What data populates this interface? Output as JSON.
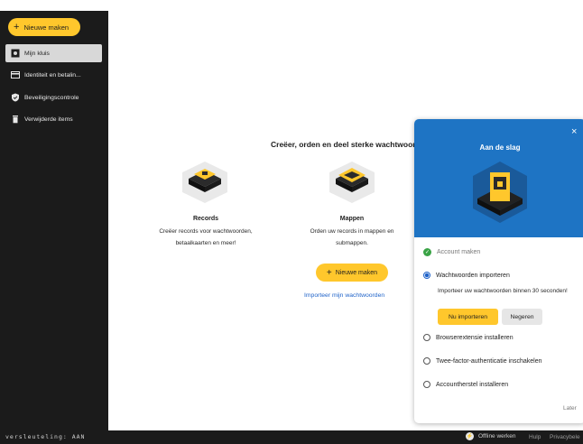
{
  "sidebar": {
    "new_label": "Nieuwe maken",
    "items": [
      {
        "label": "Mijn kluis",
        "icon": "vault-icon",
        "active": true
      },
      {
        "label": "Identiteit en betalin...",
        "icon": "card-icon",
        "active": false
      },
      {
        "label": "Beveiligingscontrole",
        "icon": "shield-icon",
        "active": false
      },
      {
        "label": "Verwijderde items",
        "icon": "trash-icon",
        "active": false
      }
    ]
  },
  "main": {
    "headline": "Creëer, orden en deel sterke wachtwoor",
    "cards": [
      {
        "title": "Records",
        "desc_lines": [
          "Creëer records voor wachtwoorden,",
          "betaalkaarten en meer!"
        ]
      },
      {
        "title": "Mappen",
        "desc_lines": [
          "Orden uw records in mappen en",
          "submappen."
        ]
      }
    ],
    "new_label": "Nieuwe maken",
    "import_link": "Importeer mijn wachtwoorden"
  },
  "panel": {
    "title": "Aan de slag",
    "close": "×",
    "steps": [
      {
        "label": "Account maken",
        "state": "done"
      },
      {
        "label": "Wachtwoorden importeren",
        "state": "current"
      },
      {
        "label": "Browserextensie installeren",
        "state": "todo"
      },
      {
        "label": "Twee-factor-authenticatie inschakelen",
        "state": "todo"
      },
      {
        "label": "Accountherstel installeren",
        "state": "todo"
      }
    ],
    "import_desc": "Importeer uw wachtwoorden binnen 30 seconden!",
    "import_now": "Nu importeren",
    "ignore": "Negeren",
    "later": "Later"
  },
  "footer": {
    "encryption": "versleuteling: AAN",
    "offline": "Offline werken",
    "help": "Hulp",
    "privacy": "Privacybele"
  },
  "colors": {
    "accent": "#ffc72c",
    "brand_blue": "#1e74c4",
    "link": "#1f63c9",
    "sidebar": "#1b1b1b"
  }
}
